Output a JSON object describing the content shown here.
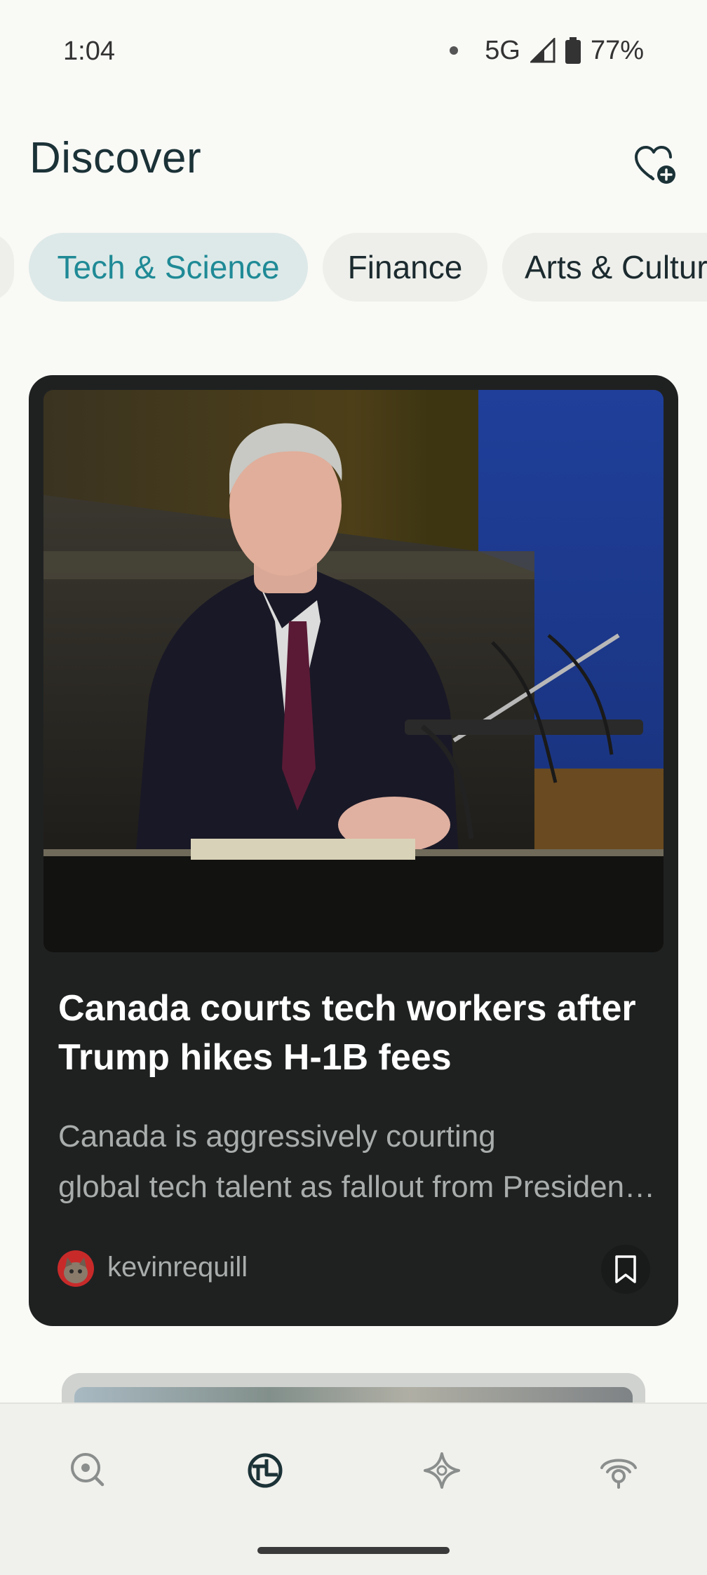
{
  "status": {
    "time": "1:04",
    "network": "5G",
    "battery": "77%"
  },
  "header": {
    "title": "Discover",
    "action_icon": "heart-plus-icon"
  },
  "categories": [
    {
      "label": "Tech & Science",
      "active": true
    },
    {
      "label": "Finance",
      "active": false
    },
    {
      "label": "Arts & Culture",
      "active": false
    }
  ],
  "article": {
    "title": "Canada courts tech workers after Trump hikes H-1B fees",
    "description_line1": "Canada is aggressively courting",
    "description_line2": "global tech talent as fallout from President…",
    "author": "kevinrequill",
    "bookmark_icon": "bookmark-icon"
  },
  "nav": [
    {
      "name": "search",
      "icon": "search-icon"
    },
    {
      "name": "discover",
      "icon": "discover-icon",
      "active": true
    },
    {
      "name": "spaces",
      "icon": "sparkle-icon"
    },
    {
      "name": "library",
      "icon": "library-icon"
    }
  ],
  "colors": {
    "accent": "#1f8a96",
    "card_bg": "#1f2121",
    "page_bg": "#f9f9f6"
  }
}
